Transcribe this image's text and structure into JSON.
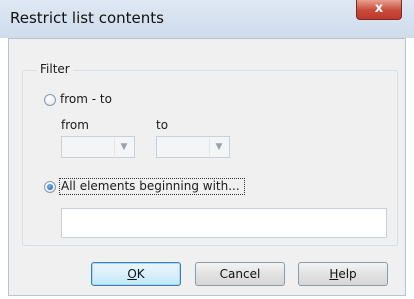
{
  "dialog": {
    "title": "Restrict list contents",
    "close_glyph": "x"
  },
  "filter": {
    "group_label": "Filter",
    "option_range": {
      "label": "from - to",
      "checked": false
    },
    "from_label": "from",
    "to_label": "to",
    "from_value": "",
    "to_value": "",
    "option_prefix": {
      "label": "All elements beginning with...",
      "checked": true
    },
    "prefix_value": ""
  },
  "buttons": {
    "ok": {
      "mnemonic": "O",
      "rest": "K"
    },
    "cancel": "Cancel",
    "help": {
      "mnemonic": "H",
      "rest": "elp"
    }
  },
  "icons": {
    "close": "close-icon",
    "dropdown": "chevron-down-icon"
  }
}
